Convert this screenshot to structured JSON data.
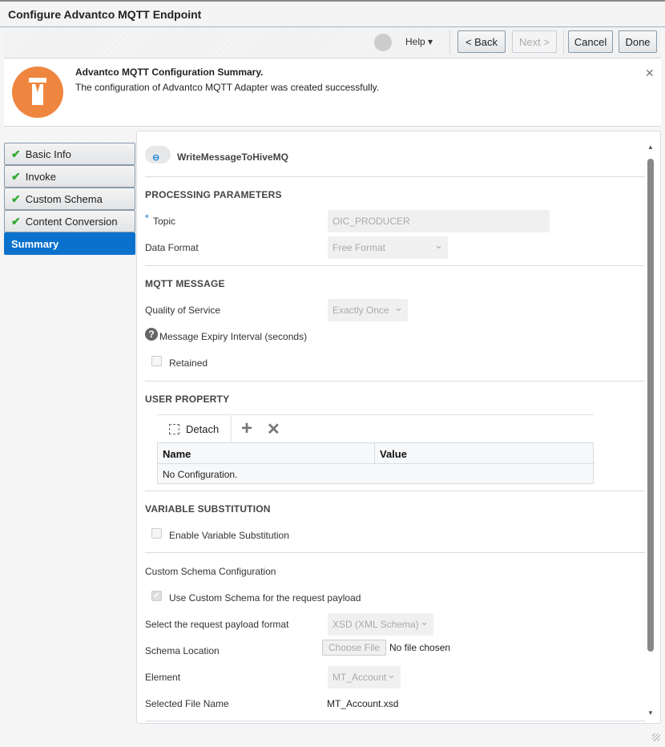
{
  "window": {
    "title": "Configure Advantco MQTT Endpoint"
  },
  "toolbar": {
    "help": "Help ▾",
    "back": "< Back",
    "next": "Next >",
    "cancel": "Cancel",
    "done": "Done"
  },
  "banner": {
    "title": "Advantco MQTT Configuration Summary.",
    "message": "The configuration of Advantco MQTT Adapter was created successfully.",
    "close": "✕"
  },
  "sidebar": {
    "items": [
      {
        "label": "Basic Info",
        "done": true
      },
      {
        "label": "Invoke",
        "done": true
      },
      {
        "label": "Custom Schema",
        "done": true
      },
      {
        "label": "Content Conversion",
        "done": true
      },
      {
        "label": "Summary",
        "active": true
      }
    ]
  },
  "main": {
    "endpoint_name": "WriteMessageToHiveMQ",
    "processing": {
      "heading": "PROCESSING PARAMETERS",
      "required_mark": "*",
      "topic_label": "Topic",
      "topic_value": "OIC_PRODUCER",
      "format_label": "Data Format",
      "format_value": "Free Format"
    },
    "mqtt": {
      "heading": "MQTT MESSAGE",
      "qos_label": "Quality of Service",
      "qos_value": "Exactly Once",
      "expiry_label": "Message Expiry Interval (seconds)",
      "retained_label": "Retained"
    },
    "user_property": {
      "heading": "USER PROPERTY",
      "detach": "Detach",
      "columns": [
        "Name",
        "Value"
      ],
      "empty": "No Configuration."
    },
    "variable": {
      "heading": "VARIABLE SUBSTITUTION",
      "enable_label": "Enable Variable Substitution"
    },
    "custom_schema": {
      "heading": "Custom Schema Configuration",
      "use_label": "Use Custom Schema for the request payload",
      "payload_label": "Select the request payload format",
      "payload_value": "XSD (XML Schema)",
      "location_label": "Schema Location",
      "choose_file": "Choose File",
      "no_file": "No file chosen",
      "element_label": "Element",
      "element_value": "MT_Account",
      "file_label": "Selected File Name",
      "file_value": "MT_Account.xsd"
    }
  },
  "colors": {
    "accent": "#0a72cc",
    "logo": "#ef8640",
    "check": "#33aa33"
  }
}
